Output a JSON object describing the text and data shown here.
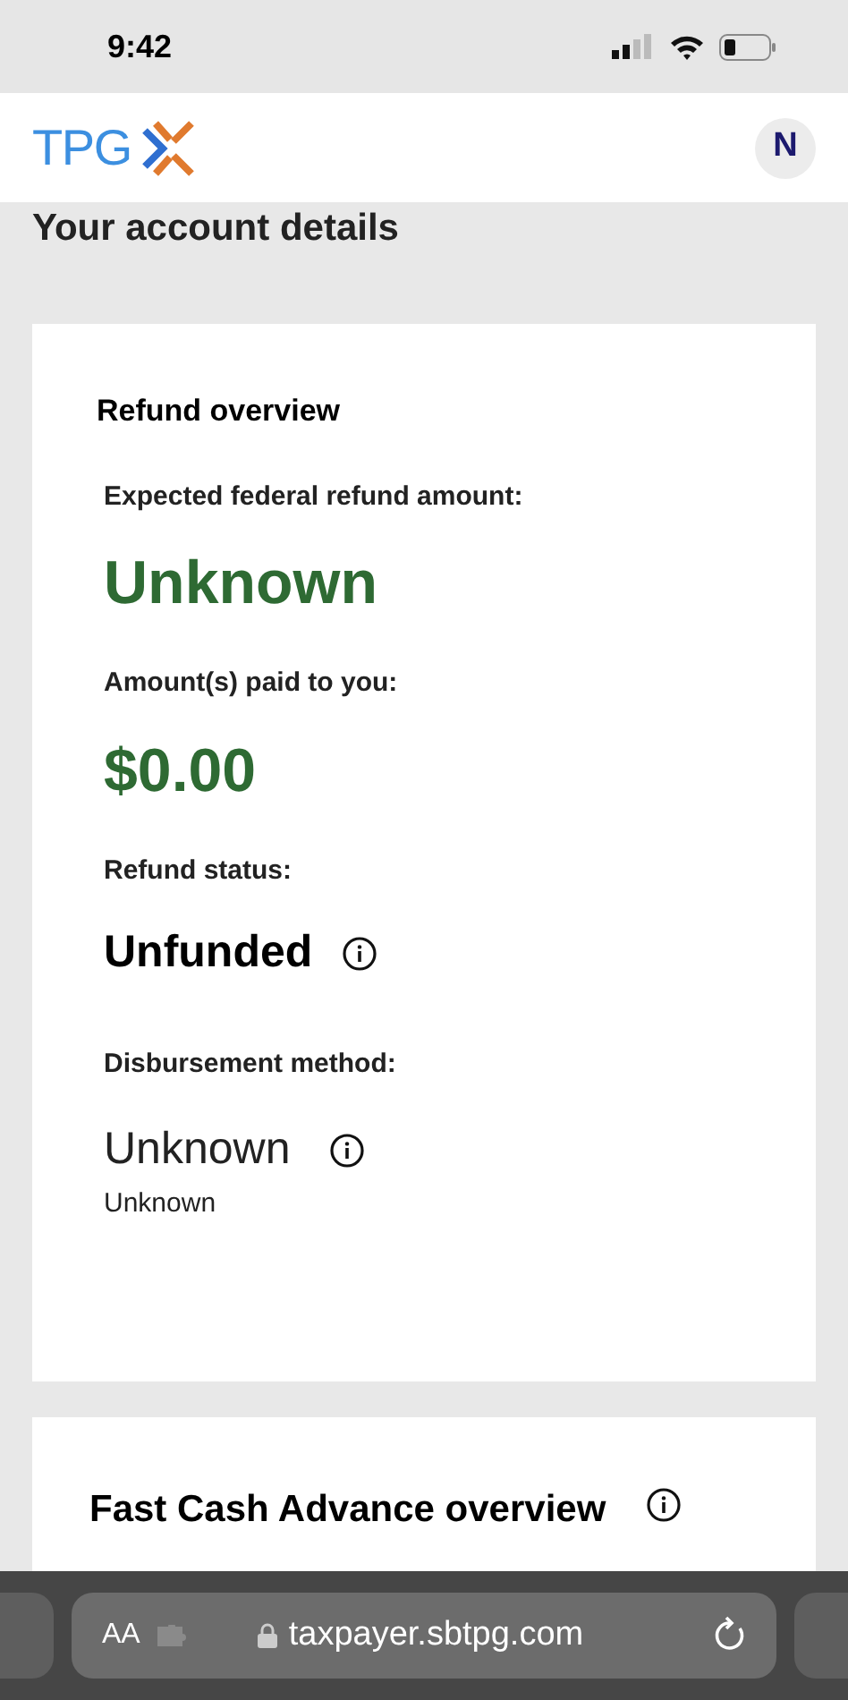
{
  "status_bar": {
    "time": "9:42"
  },
  "header": {
    "logo_text": "TPG",
    "avatar": "N"
  },
  "page_title": "Your account details",
  "refund_card": {
    "title": "Refund overview",
    "fields": [
      {
        "kind": "amount",
        "label": "Expected federal refund amount:",
        "value": "Unknown"
      },
      {
        "kind": "amount",
        "label": "Amount(s) paid to you:",
        "value": "$0.00"
      },
      {
        "kind": "status",
        "label": "Refund status:",
        "value": "Unfunded",
        "info": true
      },
      {
        "kind": "method",
        "label": "Disbursement method:",
        "value": "Unknown",
        "info": true,
        "detail": "Unknown"
      }
    ]
  },
  "advance_card": {
    "title": "Fast Cash Advance overview",
    "info": true
  },
  "browser_bar": {
    "text_size": "AA",
    "url": "taxpayer.sbtpg.com"
  }
}
